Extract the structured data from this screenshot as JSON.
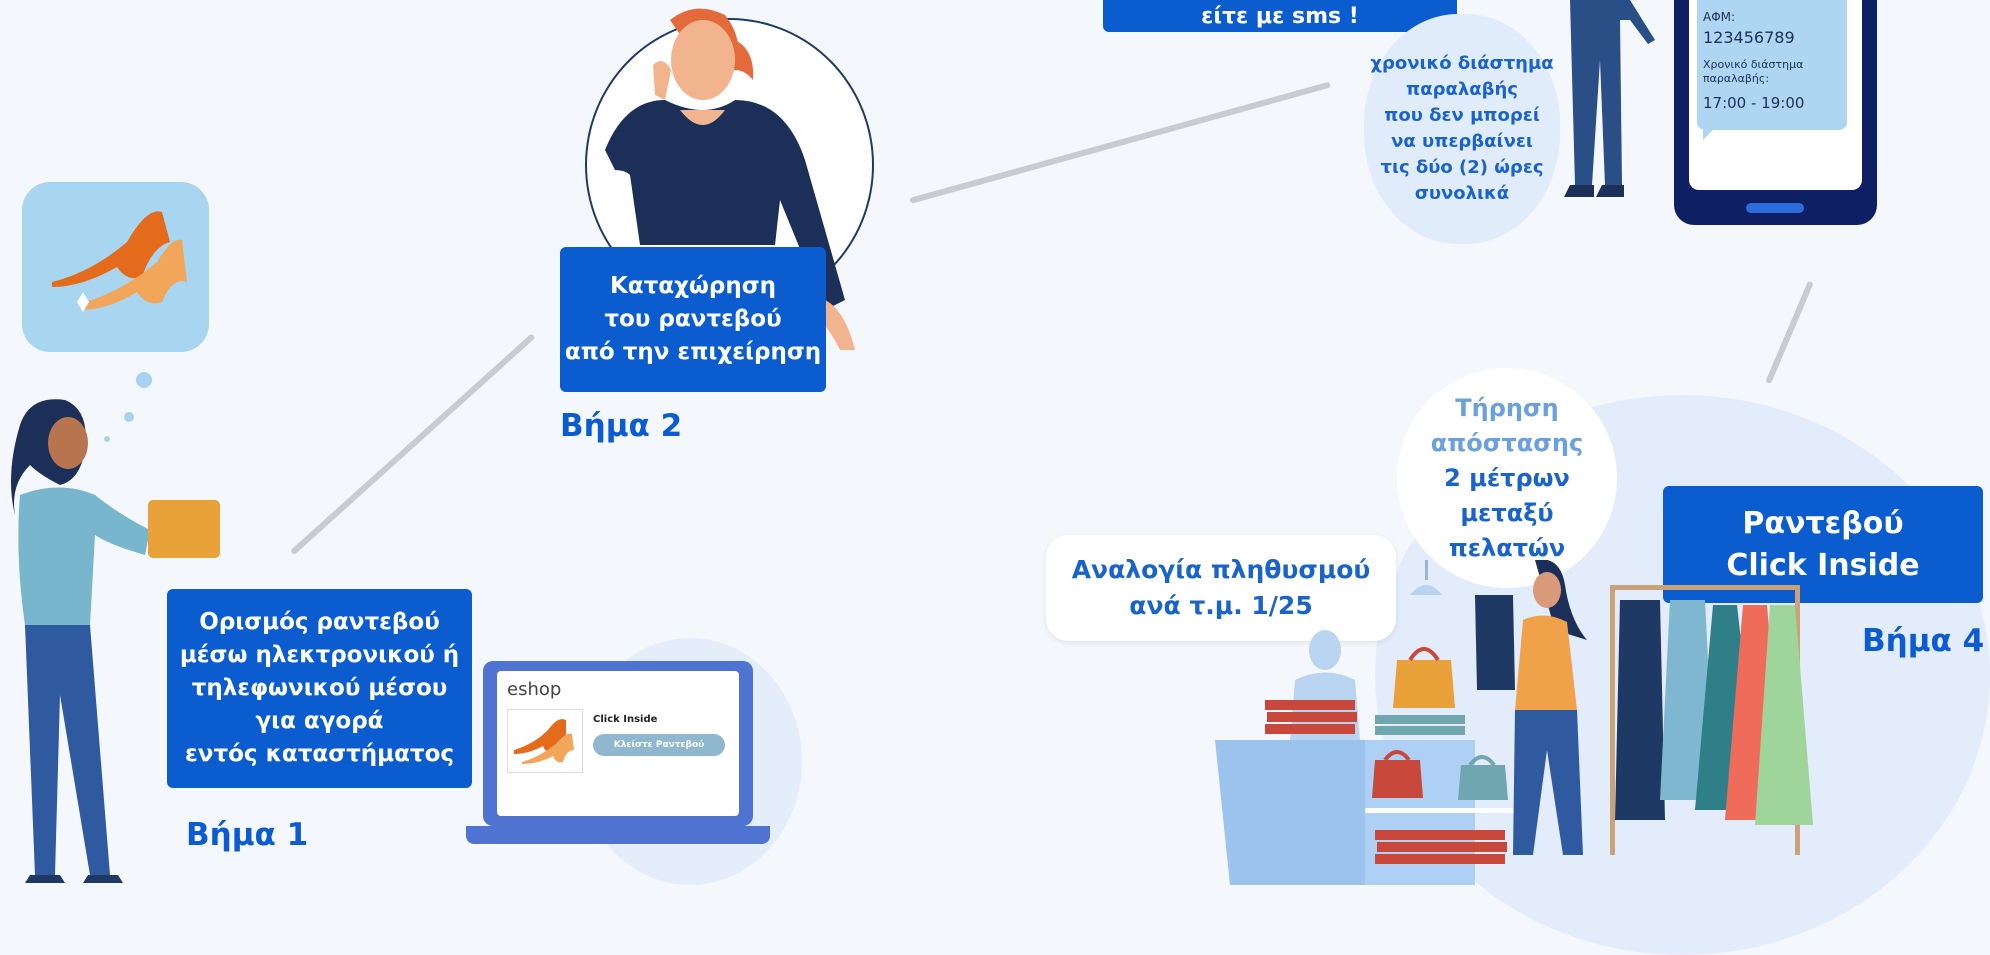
{
  "step1": {
    "box_text": "Ορισμός ραντεβού\nμέσω ηλεκτρονικού ή\nτηλεφωνικού μέσου\nγια αγορά\nεντός καταστήματος",
    "label": "Βήμα 1",
    "laptop": {
      "title": "eshop",
      "product_label": "Click Inside",
      "button_label": "Κλείστε Ραντεβού"
    }
  },
  "step2": {
    "box_text": "Καταχώρηση\nτου ραντεβού\nαπό την επιχείρηση",
    "label": "Βήμα 2"
  },
  "step3": {
    "top_box_text": "είτε με sms !",
    "bubble_text": "χρονικό διάστημα\nπαραλαβής\nπου δεν μπορεί\nνα υπερβαίνει\nτις δύο (2) ώρες\nσυνολικά",
    "phone": {
      "afm_label": "ΑΦΜ:",
      "afm_value": "123456789",
      "interval_label": "Χρονικό διάστημα\nπαραλαβής:",
      "interval_value": "17:00 - 19:00"
    }
  },
  "step4": {
    "distance_bubble": {
      "line1": "Τήρηση\nαπόστασης",
      "line2": "2 μέτρων\nμεταξύ\nπελατών"
    },
    "ratio_pill": "Αναλογία πληθυσμού\nανά τ.μ. 1/25",
    "box_text": "Ραντεβού\nClick Inside",
    "label": "Βήμα 4"
  },
  "colors": {
    "primary_blue": "#0a5ccf",
    "navy": "#1e3a64",
    "light_blue": "#a8d2ef",
    "orange": "#e3712a"
  }
}
